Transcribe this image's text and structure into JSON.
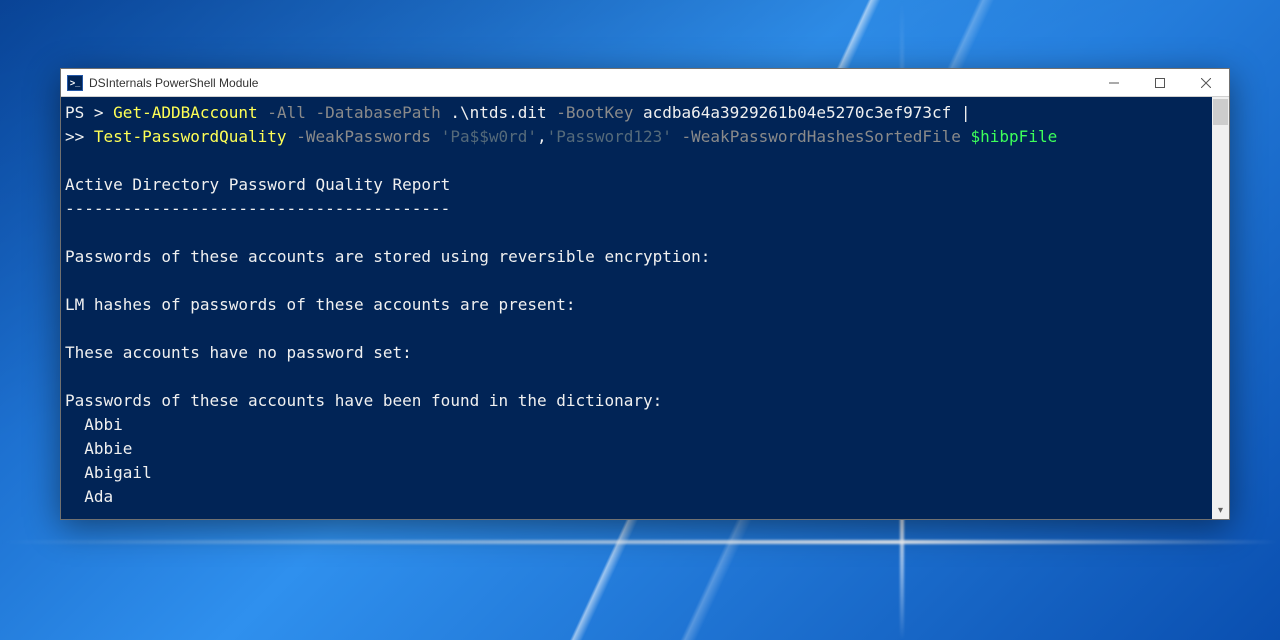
{
  "window": {
    "title": "DSInternals PowerShell Module",
    "icon_glyph": ">_"
  },
  "console": {
    "prompt1": "PS > ",
    "cmd1": "Get-ADDBAccount",
    "args1a": " -All -DatabasePath ",
    "args1b": ".\\ntds.dit",
    "args1c": " -BootKey ",
    "bootkey": "acdba64a3929261b04e5270c3ef973cf",
    "pipe": " |",
    "prompt2": ">> ",
    "cmd2": "Test-PasswordQuality",
    "arg2a": " -WeakPasswords ",
    "str1": "'Pa$$w0rd'",
    "comma": ",",
    "str2": "'Password123'",
    "arg2b": " -WeakPasswordHashesSortedFile ",
    "var": "$hibpFile",
    "blank": "",
    "report_title": "Active Directory Password Quality Report",
    "rule": "----------------------------------------",
    "sec1": "Passwords of these accounts are stored using reversible encryption:",
    "sec2": "LM hashes of passwords of these accounts are present:",
    "sec3": "These accounts have no password set:",
    "sec4": "Passwords of these accounts have been found in the dictionary:",
    "dict_users": [
      "Abbi",
      "Abbie",
      "Abigail",
      "Ada"
    ]
  },
  "colors": {
    "console_bg": "#012456",
    "accent_yellow": "#ffff55",
    "accent_green": "#3cff5a"
  }
}
